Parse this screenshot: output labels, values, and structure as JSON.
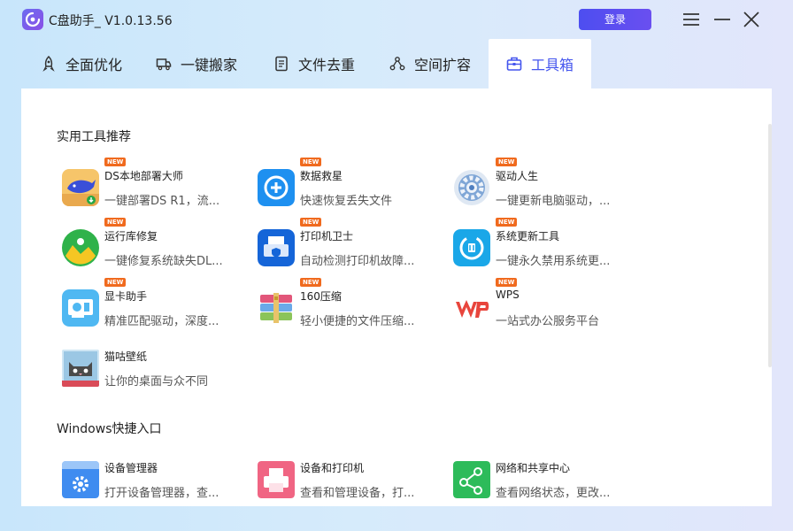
{
  "app": {
    "title": "C盘助手_ V1.0.13.56",
    "login_label": "登录"
  },
  "tabs": [
    {
      "label": "全面优化",
      "icon": "rocket-icon"
    },
    {
      "label": "一键搬家",
      "icon": "truck-icon"
    },
    {
      "label": "文件去重",
      "icon": "file-icon"
    },
    {
      "label": "空间扩容",
      "icon": "expand-icon"
    },
    {
      "label": "工具箱",
      "icon": "toolbox-icon",
      "active": true
    }
  ],
  "sections": {
    "tools_title": "实用工具推荐",
    "windows_title": "Windows快捷入口"
  },
  "tools": [
    {
      "name": "DS本地部署大师",
      "desc": "一键部署DS R1，流...",
      "badge": "NEW",
      "icon": "deepseek-whale-icon"
    },
    {
      "name": "数据救星",
      "desc": "快速恢复丢失文件",
      "badge": "NEW",
      "icon": "data-recovery-icon"
    },
    {
      "name": "驱动人生",
      "desc": "一键更新电脑驱动，...",
      "badge": "NEW",
      "icon": "driver-gear-icon"
    },
    {
      "name": "运行库修复",
      "desc": "一键修复系统缺失DL...",
      "badge": "NEW",
      "icon": "runtime-repair-icon"
    },
    {
      "name": "打印机卫士",
      "desc": "自动检测打印机故障...",
      "badge": "NEW",
      "icon": "printer-guard-icon"
    },
    {
      "name": "系统更新工具",
      "desc": "一键永久禁用系统更...",
      "badge": "NEW",
      "icon": "system-update-icon"
    },
    {
      "name": "显卡助手",
      "desc": "精准匹配驱动，深度...",
      "badge": "NEW",
      "icon": "graphics-card-icon"
    },
    {
      "name": "160压缩",
      "desc": "轻小便捷的文件压缩...",
      "badge": "NEW",
      "icon": "archive-books-icon"
    },
    {
      "name": "WPS",
      "desc": "一站式办公服务平台",
      "badge": "NEW",
      "icon": "wps-icon"
    },
    {
      "name": "猫咕壁纸",
      "desc": "让你的桌面与众不同",
      "badge": "",
      "icon": "cat-wallpaper-icon"
    }
  ],
  "windows_entries": [
    {
      "name": "设备管理器",
      "desc": "打开设备管理器，查...",
      "icon": "device-manager-icon"
    },
    {
      "name": "设备和打印机",
      "desc": "查看和管理设备，打...",
      "icon": "devices-printers-icon"
    },
    {
      "name": "网络和共享中心",
      "desc": "查看网络状态，更改...",
      "icon": "network-share-icon"
    }
  ],
  "colors": {
    "accent": "#4455ee",
    "badge": "#f06a1e"
  }
}
